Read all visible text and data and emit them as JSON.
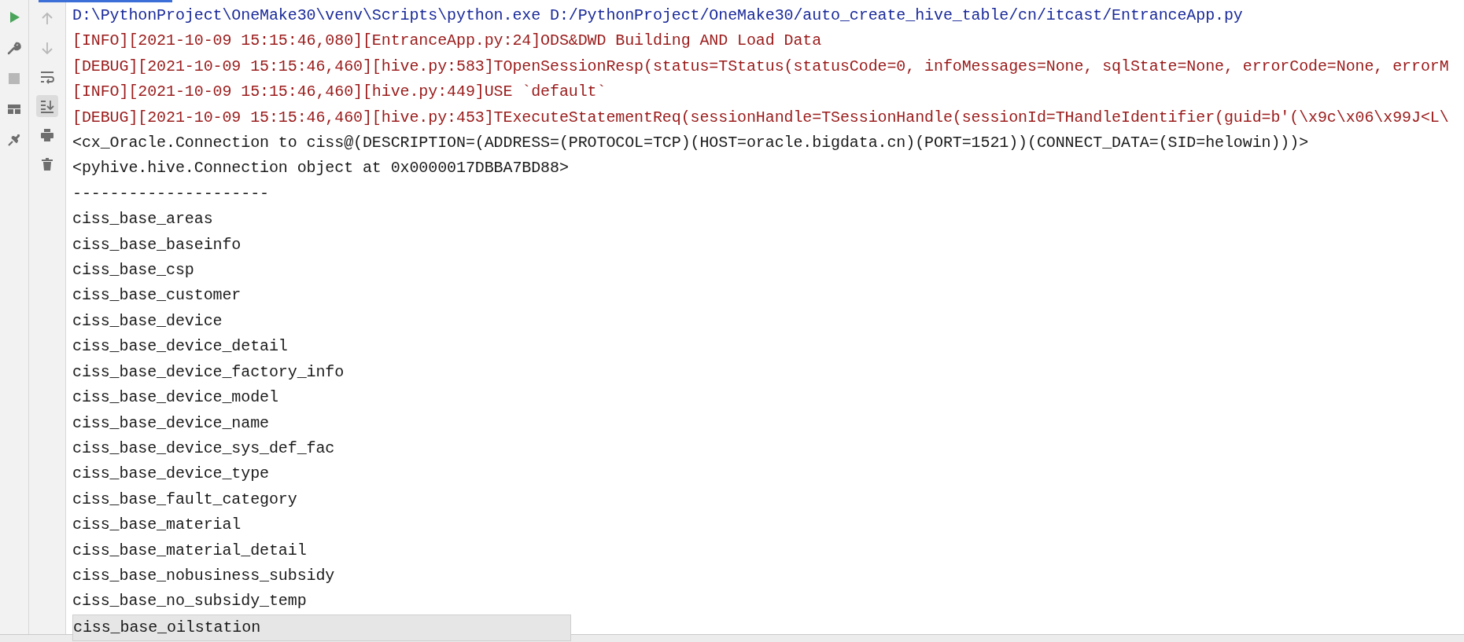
{
  "toolbar_left": [
    {
      "kind": "run",
      "disabled": false
    },
    {
      "kind": "wrench",
      "disabled": false
    },
    {
      "kind": "stop",
      "disabled": true
    },
    {
      "kind": "layout",
      "disabled": false
    },
    {
      "kind": "pin",
      "disabled": false
    }
  ],
  "toolbar_right": [
    {
      "kind": "up",
      "disabled": true,
      "selected": false
    },
    {
      "kind": "down",
      "disabled": true,
      "selected": false
    },
    {
      "kind": "wrap",
      "disabled": false,
      "selected": false
    },
    {
      "kind": "scroll-end",
      "disabled": false,
      "selected": true
    },
    {
      "kind": "print",
      "disabled": false,
      "selected": false
    },
    {
      "kind": "trash",
      "disabled": false,
      "selected": false
    }
  ],
  "console_lines": [
    {
      "kind": "command",
      "text": "D:\\PythonProject\\OneMake30\\venv\\Scripts\\python.exe D:/PythonProject/OneMake30/auto_create_hive_table/cn/itcast/EntranceApp.py",
      "selected": false
    },
    {
      "kind": "log",
      "text": "[INFO][2021-10-09 15:15:46,080][EntranceApp.py:24]ODS&DWD Building AND Load Data",
      "selected": false
    },
    {
      "kind": "log",
      "text": "[DEBUG][2021-10-09 15:15:46,460][hive.py:583]TOpenSessionResp(status=TStatus(statusCode=0, infoMessages=None, sqlState=None, errorCode=None, errorM",
      "selected": false
    },
    {
      "kind": "log",
      "text": "[INFO][2021-10-09 15:15:46,460][hive.py:449]USE `default`",
      "selected": false
    },
    {
      "kind": "log",
      "text": "[DEBUG][2021-10-09 15:15:46,460][hive.py:453]TExecuteStatementReq(sessionHandle=TSessionHandle(sessionId=THandleIdentifier(guid=b'(\\x9c\\x06\\x99J<L\\",
      "selected": false
    },
    {
      "kind": "output",
      "text": "<cx_Oracle.Connection to ciss@(DESCRIPTION=(ADDRESS=(PROTOCOL=TCP)(HOST=oracle.bigdata.cn)(PORT=1521))(CONNECT_DATA=(SID=helowin)))>",
      "selected": false
    },
    {
      "kind": "output",
      "text": "<pyhive.hive.Connection object at 0x0000017DBBA7BD88>",
      "selected": false
    },
    {
      "kind": "output",
      "text": "---------------------",
      "selected": false
    },
    {
      "kind": "output",
      "text": "ciss_base_areas",
      "selected": false
    },
    {
      "kind": "output",
      "text": "ciss_base_baseinfo",
      "selected": false
    },
    {
      "kind": "output",
      "text": "ciss_base_csp",
      "selected": false
    },
    {
      "kind": "output",
      "text": "ciss_base_customer",
      "selected": false
    },
    {
      "kind": "output",
      "text": "ciss_base_device",
      "selected": false
    },
    {
      "kind": "output",
      "text": "ciss_base_device_detail",
      "selected": false
    },
    {
      "kind": "output",
      "text": "ciss_base_device_factory_info",
      "selected": false
    },
    {
      "kind": "output",
      "text": "ciss_base_device_model",
      "selected": false
    },
    {
      "kind": "output",
      "text": "ciss_base_device_name",
      "selected": false
    },
    {
      "kind": "output",
      "text": "ciss_base_device_sys_def_fac",
      "selected": false
    },
    {
      "kind": "output",
      "text": "ciss_base_device_type",
      "selected": false
    },
    {
      "kind": "output",
      "text": "ciss_base_fault_category",
      "selected": false
    },
    {
      "kind": "output",
      "text": "ciss_base_material",
      "selected": false
    },
    {
      "kind": "output",
      "text": "ciss_base_material_detail",
      "selected": false
    },
    {
      "kind": "output",
      "text": "ciss_base_nobusiness_subsidy",
      "selected": false
    },
    {
      "kind": "output",
      "text": "ciss_base_no_subsidy_temp",
      "selected": false
    },
    {
      "kind": "output",
      "text": "ciss_base_oilstation",
      "selected": true
    }
  ]
}
